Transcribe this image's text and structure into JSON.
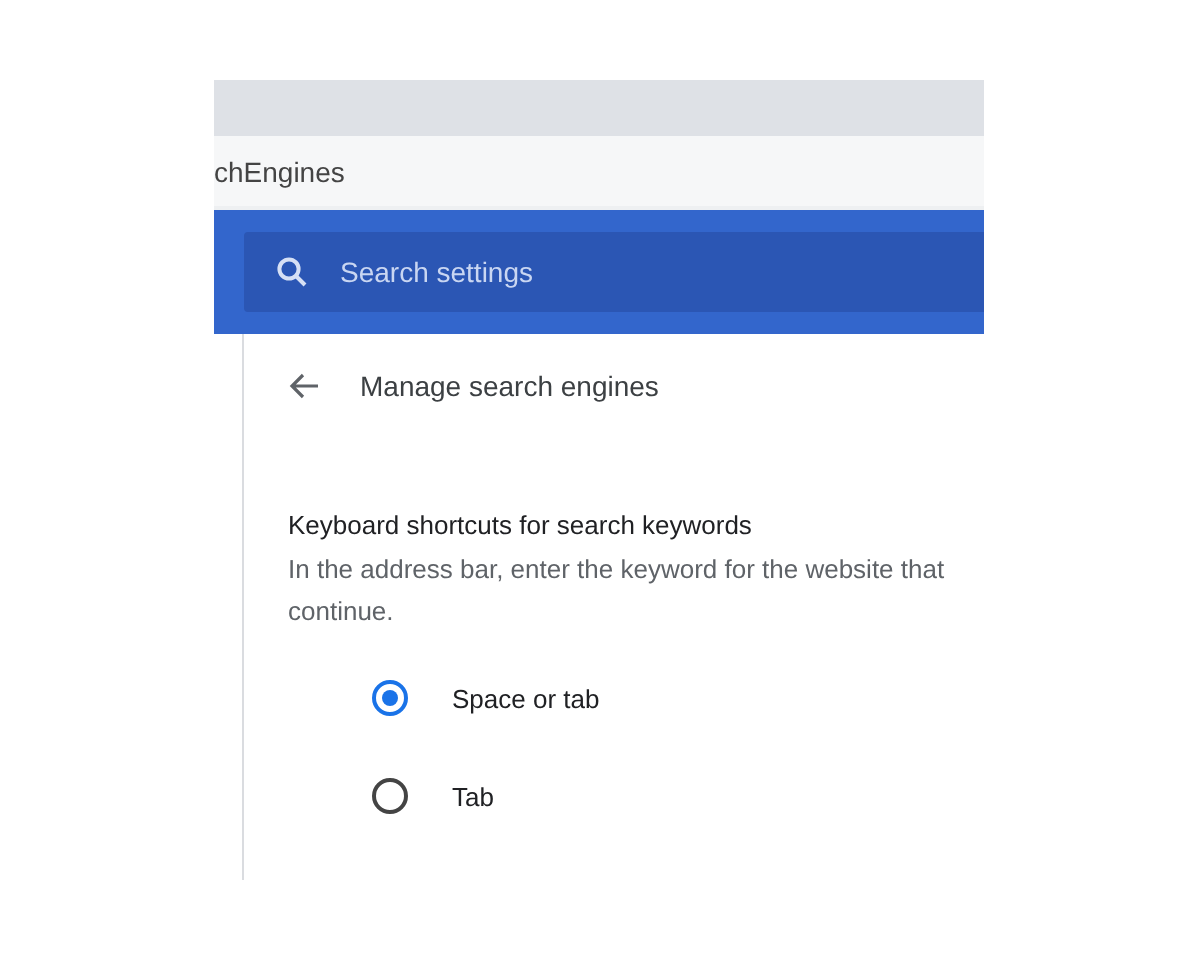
{
  "address_bar": {
    "text": "chEngines"
  },
  "search": {
    "placeholder": "Search settings"
  },
  "page": {
    "title": "Manage search engines"
  },
  "section": {
    "heading": "Keyboard shortcuts for search keywords",
    "description_lines": [
      "In the address bar, enter the keyword for the website that",
      "continue."
    ]
  },
  "options": [
    {
      "label": "Space or tab",
      "selected": true
    },
    {
      "label": "Tab",
      "selected": false
    }
  ]
}
